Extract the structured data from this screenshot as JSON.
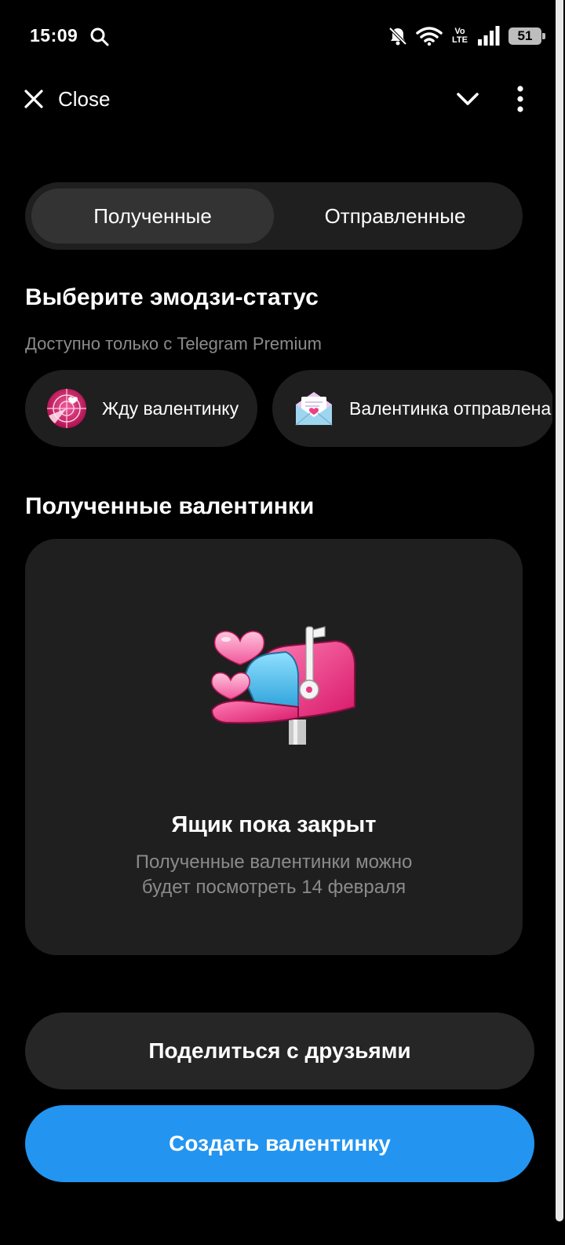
{
  "status_bar": {
    "time": "15:09",
    "volte": "Vo\nLTE",
    "battery": "51",
    "icons": [
      "search-icon",
      "bell-off-icon",
      "wifi-icon",
      "volte-icon",
      "signal-icon",
      "battery-icon"
    ]
  },
  "header": {
    "close_label": "Close",
    "icons": [
      "close-icon",
      "chevron-down-icon",
      "more-vertical-icon"
    ]
  },
  "tabs": [
    {
      "label": "Полученные",
      "active": true
    },
    {
      "label": "Отправленные",
      "active": false
    }
  ],
  "emoji_section": {
    "title": "Выберите эмодзи-статус",
    "subtitle": "Доступно только с Telegram Premium",
    "chips": [
      {
        "label": "Жду валентинку",
        "icon": "radar-heart-icon"
      },
      {
        "label": "Валентинка отправлена",
        "icon": "love-letter-icon"
      }
    ]
  },
  "received_section": {
    "title": "Полученные валентинки",
    "card": {
      "illustration": "mailbox-hearts-icon",
      "title": "Ящик пока закрыт",
      "text": "Полученные валентинки можно будет посмотреть 14 февраля"
    }
  },
  "buttons": {
    "share": "Поделиться с друзьями",
    "create": "Создать валентинку"
  },
  "colors": {
    "background": "#000000",
    "surface": "#1f1f1f",
    "accent": "#2394f0",
    "muted_text": "#8b8b8b",
    "pink": "#e8337e"
  }
}
